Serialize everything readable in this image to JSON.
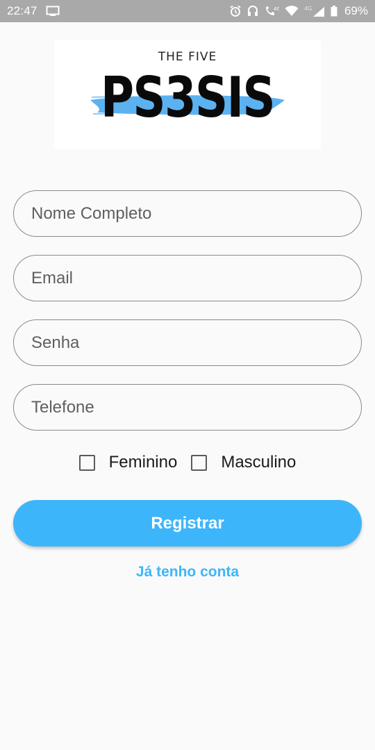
{
  "status_bar": {
    "time": "22:47",
    "battery": "69%",
    "network_1": "4G",
    "network_2": "4G",
    "icons": [
      "screen-icon",
      "alarm-icon",
      "headset-icon",
      "call-icon",
      "wifi-icon",
      "signal-icon",
      "battery-icon"
    ]
  },
  "logo": {
    "top_text": "THE FIVE",
    "main_text": "PS3SIS",
    "brush_color": "#4aaaf0"
  },
  "form": {
    "name_placeholder": "Nome Completo",
    "email_placeholder": "Email",
    "password_placeholder": "Senha",
    "phone_placeholder": "Telefone",
    "gender_options": [
      {
        "label": "Feminino",
        "checked": false
      },
      {
        "label": "Masculino",
        "checked": false
      }
    ],
    "register_label": "Registrar",
    "login_link": "Já tenho conta"
  },
  "colors": {
    "accent": "#3db5fb",
    "status_bar": "#a9a9a9",
    "background": "#fafafa"
  }
}
